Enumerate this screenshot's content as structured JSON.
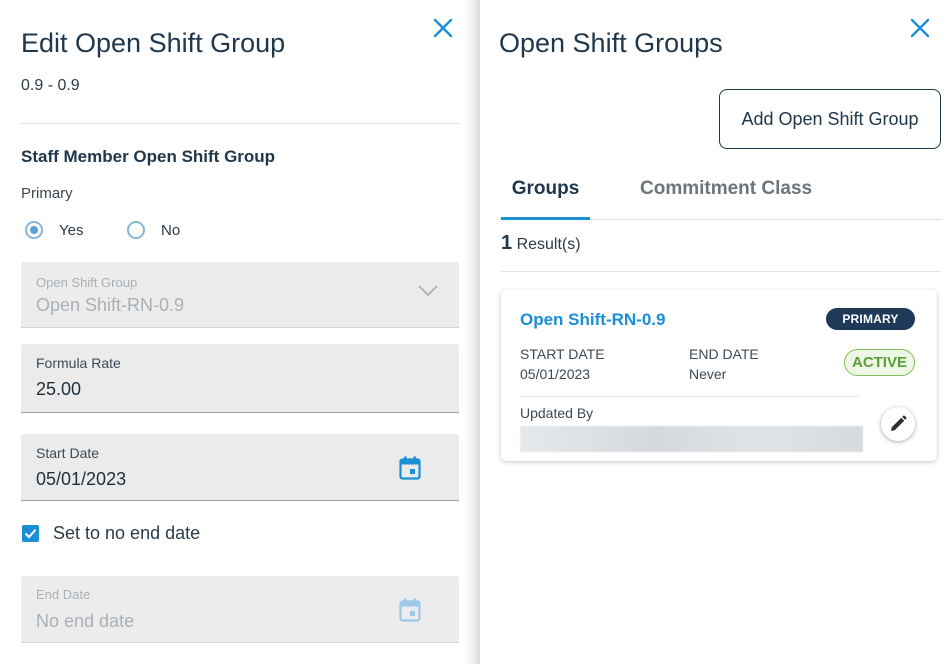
{
  "left_panel": {
    "title": "Edit Open Shift Group",
    "subtitle": "0.9 - 0.9",
    "section_title": "Staff Member Open Shift Group",
    "primary_label": "Primary",
    "radio_yes": "Yes",
    "radio_no": "No",
    "primary_selected": "Yes",
    "open_shift_group": {
      "label": "Open Shift Group",
      "value": "Open Shift-RN-0.9",
      "disabled": true
    },
    "formula_rate": {
      "label": "Formula Rate",
      "value": "25.00"
    },
    "start_date": {
      "label": "Start Date",
      "value": "05/01/2023"
    },
    "no_end_date": {
      "label": "Set to no end date",
      "checked": true
    },
    "end_date": {
      "label": "End Date",
      "placeholder": "No end date",
      "disabled": true
    }
  },
  "right_panel": {
    "title": "Open Shift Groups",
    "add_button": "Add Open Shift Group",
    "tabs": [
      {
        "label": "Groups",
        "active": true
      },
      {
        "label": "Commitment Class",
        "active": false
      }
    ],
    "results_count": "1",
    "results_label": "Result(s)",
    "card": {
      "title": "Open Shift-RN-0.9",
      "primary_badge": "PRIMARY",
      "start_date_label": "START DATE",
      "start_date_value": "05/01/2023",
      "end_date_label": "END DATE",
      "end_date_value": "Never",
      "status_badge": "ACTIVE",
      "updated_by_label": "Updated By"
    }
  },
  "icons": {
    "close": "close-icon",
    "chevron": "chevron-down-icon",
    "calendar": "calendar-icon",
    "check": "check-icon",
    "edit": "pencil-icon"
  },
  "colors": {
    "accent": "#1b8fd6",
    "heading": "#21384c",
    "primary_badge_bg": "#1f3a58",
    "active_green": "#5a9e35"
  }
}
